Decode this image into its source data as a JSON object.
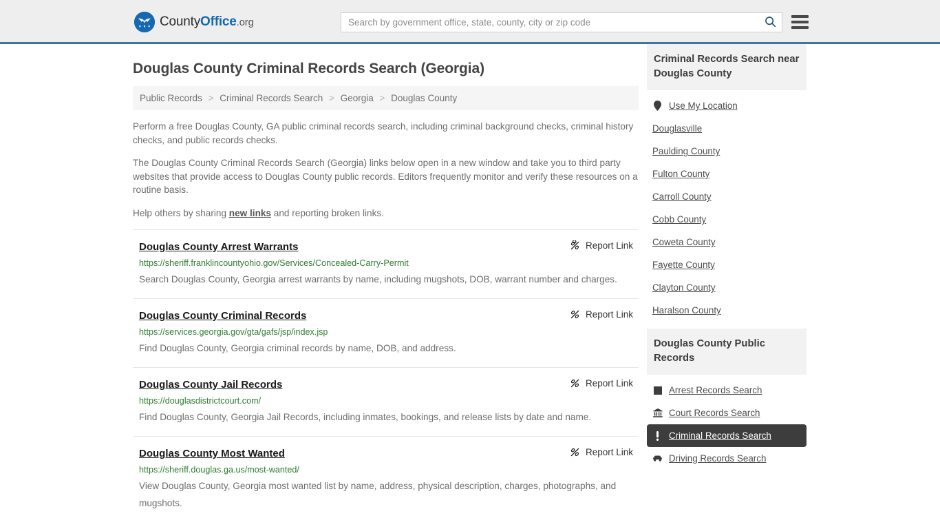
{
  "header": {
    "logo": {
      "icon": "eagle-seal-icon",
      "text_county": "County",
      "text_office": "Office",
      "text_org": ".org"
    },
    "search": {
      "placeholder": "Search by government office, state, county, city or zip code",
      "value": "",
      "icon": "search-icon"
    },
    "menu_icon": "hamburger-menu-icon",
    "accent_color": "#3a76a8",
    "background_color": "#eeeeee"
  },
  "page": {
    "title": "Douglas County Criminal Records Search (Georgia)"
  },
  "breadcrumb": {
    "separator": ">",
    "items": [
      {
        "label": "Public Records"
      },
      {
        "label": "Criminal Records Search"
      },
      {
        "label": "Georgia"
      },
      {
        "label": "Douglas County"
      }
    ]
  },
  "intro": {
    "paragraph_1": "Perform a free Douglas County, GA public criminal records search, including criminal background checks, criminal history checks, and public records checks.",
    "paragraph_2": "The Douglas County Criminal Records Search (Georgia) links below open in a new window and take you to third party websites that provide access to Douglas County public records. Editors frequently monitor and verify these resources on a routine basis.",
    "paragraph_3_before": "Help others by sharing ",
    "paragraph_3_link": "new links",
    "paragraph_3_after": " and reporting broken links."
  },
  "results": {
    "report_label": "Report Link",
    "report_icon": "broken-link-icon",
    "items": [
      {
        "title": "Douglas County Arrest Warrants",
        "url": "https://sheriff.franklincountyohio.gov/Services/Concealed-Carry-Permit",
        "description": "Search Douglas County, Georgia arrest warrants by name, including mugshots, DOB, warrant number and charges."
      },
      {
        "title": "Douglas County Criminal Records",
        "url": "https://services.georgia.gov/gta/gafs/jsp/index.jsp",
        "description": "Find Douglas County, Georgia criminal records by name, DOB, and address."
      },
      {
        "title": "Douglas County Jail Records",
        "url": "https://douglasdistrictcourt.com/",
        "description": "Find Douglas County, Georgia Jail Records, including inmates, bookings, and release lists by date and name."
      },
      {
        "title": "Douglas County Most Wanted",
        "url": "https://sheriff.douglas.ga.us/most-wanted/",
        "description": "View Douglas County, Georgia most wanted list by name, address, physical description, charges, photographs, and mugshots."
      }
    ]
  },
  "sidebar": {
    "nearby": {
      "heading": "Criminal Records Search near Douglas County",
      "items": [
        {
          "label": "Use My Location",
          "icon": "map-pin-icon"
        },
        {
          "label": "Douglasville",
          "icon": ""
        },
        {
          "label": "Paulding County",
          "icon": ""
        },
        {
          "label": "Fulton County",
          "icon": ""
        },
        {
          "label": "Carroll County",
          "icon": ""
        },
        {
          "label": "Cobb County",
          "icon": ""
        },
        {
          "label": "Coweta County",
          "icon": ""
        },
        {
          "label": "Fayette County",
          "icon": ""
        },
        {
          "label": "Clayton County",
          "icon": ""
        },
        {
          "label": "Haralson County",
          "icon": ""
        }
      ]
    },
    "public_records": {
      "heading": "Douglas County Public Records",
      "items": [
        {
          "label": "Arrest Records Search",
          "icon": "fingerprint-card-icon",
          "active": false
        },
        {
          "label": "Court Records Search",
          "icon": "courthouse-icon",
          "active": false
        },
        {
          "label": "Criminal Records Search",
          "icon": "exclamation-icon",
          "active": true
        },
        {
          "label": "Driving Records Search",
          "icon": "car-icon",
          "active": false
        }
      ]
    }
  }
}
